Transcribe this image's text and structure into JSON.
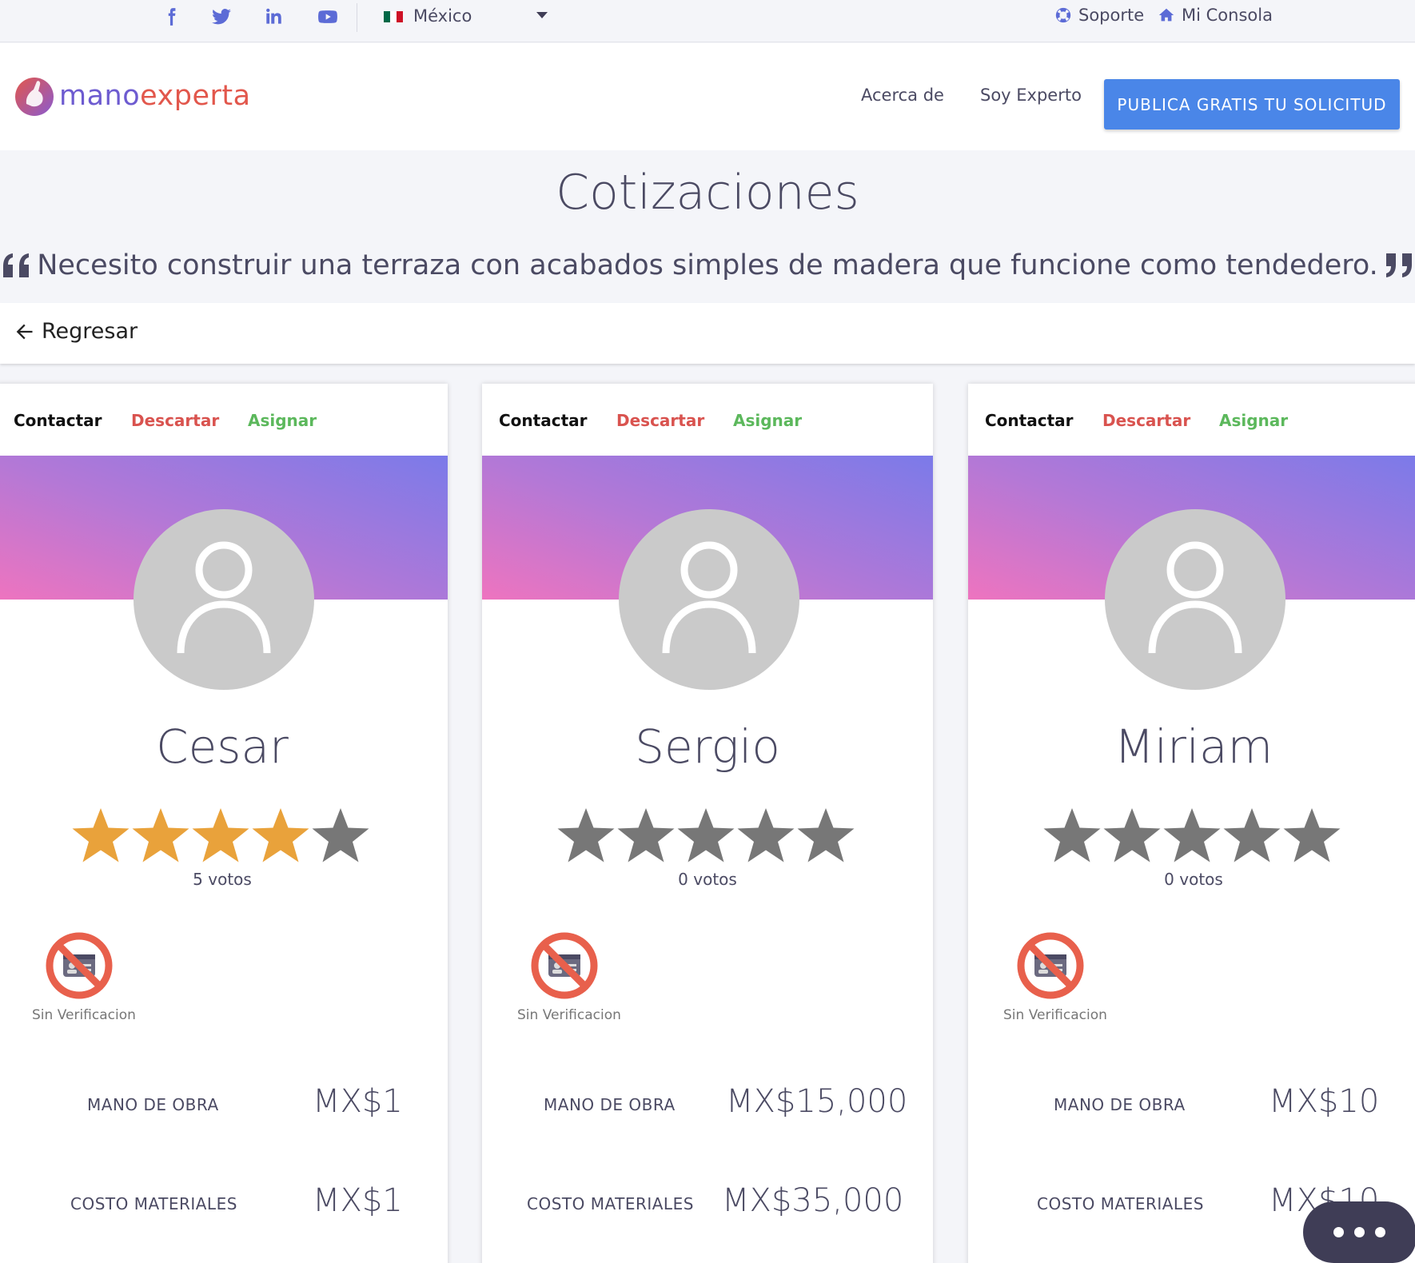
{
  "topbar": {
    "social": [
      "facebook-icon",
      "twitter-icon",
      "linkedin-icon",
      "youtube-icon"
    ],
    "country": "México",
    "links": [
      {
        "label": "Soporte",
        "icon": "lifebuoy-icon"
      },
      {
        "label": "Mi Consola",
        "icon": "home-icon"
      }
    ]
  },
  "navbar": {
    "logo": {
      "part1": "mano",
      "part2": "experta"
    },
    "links": [
      "Acerca de",
      "Soy Experto"
    ],
    "cta": "PUBLICA GRATIS TU SOLICITUD"
  },
  "page": {
    "title": "Cotizaciones",
    "quote": "Necesito construir una terraza con acabados simples de madera que funcione como tendedero.",
    "back": "Regresar"
  },
  "actions": {
    "contact": "Contactar",
    "discard": "Descartar",
    "assign": "Asignar"
  },
  "labels": {
    "verification": "Sin Verificacion",
    "labor": "MANO DE OBRA",
    "materials": "COSTO MATERIALES"
  },
  "quotes": [
    {
      "name": "Cesar",
      "rating": 4,
      "max_rating": 5,
      "votes": "5 votos",
      "labor": "MX$1",
      "materials": "MX$1"
    },
    {
      "name": "Sergio",
      "rating": 0,
      "max_rating": 5,
      "votes": "0 votos",
      "labor": "MX$15,000",
      "materials": "MX$35,000"
    },
    {
      "name": "Miriam",
      "rating": 0,
      "max_rating": 5,
      "votes": "0 votos",
      "labor": "MX$10",
      "materials": "MX$10"
    }
  ],
  "colors": {
    "accent": "#5c6bd6",
    "cta": "#4a86e8",
    "star_filled": "#e9a23b",
    "star_empty": "#777777",
    "discard": "#d9534f",
    "assign": "#5cb85c",
    "brand_mano": "#6d5bd0",
    "brand_experta": "#e2574c"
  }
}
